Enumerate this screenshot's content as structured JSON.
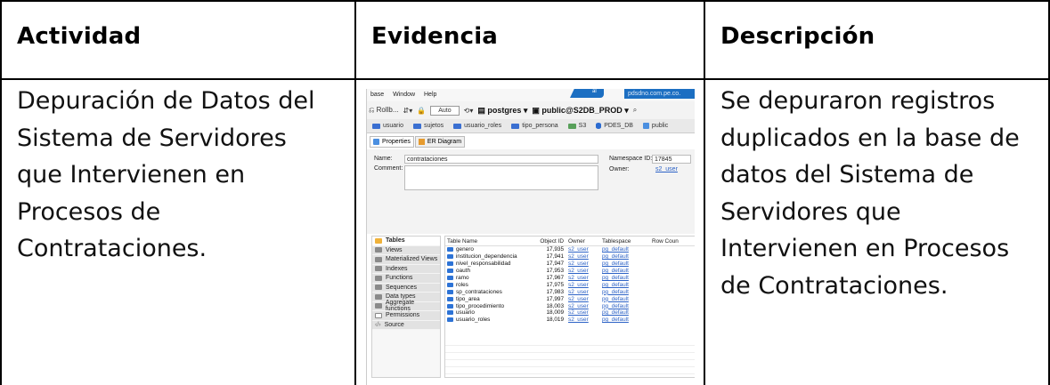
{
  "table": {
    "headers": {
      "actividad": "Actividad",
      "evidencia": "Evidencia",
      "descripcion": "Descripción"
    },
    "actividad_lines": [
      "Depuración de Datos del",
      "Sistema de Servidores",
      "que Intervienen en",
      "Procesos de",
      "Contrataciones."
    ],
    "descripcion_lines": [
      "Se depuraron registros",
      "duplicados en la base de",
      "datos del Sistema de",
      "Servidores que",
      "Intervienen en Procesos",
      "de Contrataciones."
    ]
  },
  "screenshot": {
    "menu": [
      "base",
      "Window",
      "Help"
    ],
    "top_tab_label": "al",
    "top_right_text": "pdsdno.com.pe.co.",
    "toolbar": {
      "rollback": "Rollb...",
      "auto": "Auto",
      "database": "postgres",
      "schema": "public@S2DB_PROD"
    },
    "db_tabs": [
      "usuario",
      "sujetos",
      "usuario_roles",
      "tipo_persona",
      "S3",
      "PDES_DB",
      "public"
    ],
    "editor_tabs": [
      "Properties",
      "ER Diagram"
    ],
    "form": {
      "name_label": "Name:",
      "name_value": "contrataciones",
      "comment_label": "Comment:",
      "namespace_label": "Namespace ID:",
      "namespace_value": "17845",
      "owner_label": "Owner:",
      "owner_value": "s2_user"
    },
    "nav_items": [
      "Tables",
      "Views",
      "Materialized Views",
      "Indexes",
      "Functions",
      "Sequences",
      "Data types",
      "Aggregate functions",
      "Permissions",
      "Source"
    ],
    "grid_columns": [
      "Table Name",
      "Object ID",
      "Owner",
      "Tablespace",
      "Row Coun"
    ],
    "grid_rows": [
      {
        "name": "genero",
        "oid": "17,935",
        "owner": "s2_user",
        "tablespace": "pg_default"
      },
      {
        "name": "institucion_dependencia",
        "oid": "17,941",
        "owner": "s2_user",
        "tablespace": "pg_default"
      },
      {
        "name": "nivel_responsabilidad",
        "oid": "17,947",
        "owner": "s2_user",
        "tablespace": "pg_default"
      },
      {
        "name": "oauth",
        "oid": "17,953",
        "owner": "s2_user",
        "tablespace": "pg_default"
      },
      {
        "name": "ramo",
        "oid": "17,967",
        "owner": "s2_user",
        "tablespace": "pg_default"
      },
      {
        "name": "roles",
        "oid": "17,975",
        "owner": "s2_user",
        "tablespace": "pg_default"
      },
      {
        "name": "sp_contrataciones",
        "oid": "17,983",
        "owner": "s2_user",
        "tablespace": "pg_default"
      },
      {
        "name": "tipo_area",
        "oid": "17,997",
        "owner": "s2_user",
        "tablespace": "pg_default"
      },
      {
        "name": "tipo_procedimiento",
        "oid": "18,003",
        "owner": "s2_user",
        "tablespace": "pg_default"
      },
      {
        "name": "usuario",
        "oid": "18,009",
        "owner": "s2_user",
        "tablespace": "pg_default"
      },
      {
        "name": "usuario_roles",
        "oid": "18,019",
        "owner": "s2_user",
        "tablespace": "pg_default"
      }
    ]
  }
}
